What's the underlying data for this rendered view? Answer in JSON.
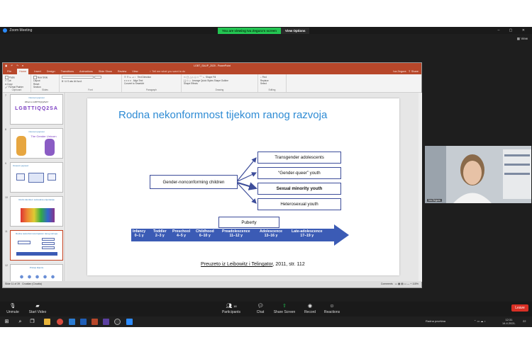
{
  "zoom": {
    "app_title": "Zoom Meeting",
    "share_banner": "You are viewing Iva Zegura's screen",
    "view_options": "View Options",
    "view": "View",
    "presenter_name": "Iva Zegura",
    "controls": {
      "unmute": "Unmute",
      "start_video": "Start Video",
      "participants": "Participants",
      "participants_count": "18",
      "chat": "Chat",
      "share_screen": "Share Screen",
      "record": "Record",
      "reactions": "Reactions",
      "leave": "Leave"
    }
  },
  "ppt": {
    "window_title": "LGBT_SALIP_2020 - PowerPoint",
    "tabs": [
      "File",
      "Home",
      "Insert",
      "Design",
      "Transitions",
      "Animations",
      "Slide Show",
      "Review",
      "View"
    ],
    "active_tab": "Home",
    "tell_me": "Tell me what you want to do",
    "user": "Iva Zegura",
    "share": "Share",
    "ribbon": {
      "clipboard": "Clipboard",
      "paste": "Paste",
      "cut": "Cut",
      "copy": "Copy",
      "format_painter": "Format Painter",
      "slides": "Slides",
      "new_slide": "New Slide",
      "layout": "Layout",
      "reset": "Reset",
      "section": "Section",
      "font": "Font",
      "paragraph": "Paragraph",
      "drawing": "Drawing",
      "editing": "Editing",
      "text_direction": "Text Direction",
      "align_text": "Align Text",
      "convert_smartart": "Convert to SmartArt",
      "arrange": "Arrange",
      "quick_styles": "Quick Styles",
      "shape_fill": "Shape Fill",
      "shape_outline": "Shape Outline",
      "shape_effects": "Shape Effects",
      "find": "Find",
      "replace": "Replace",
      "select": "Select"
    },
    "thumbnails": {
      "numbers": [
        "7",
        "8",
        "9",
        "10",
        "11",
        "12"
      ],
      "t7_title": "Osnovni pojmovi",
      "t7_sub": "What is LGBTTIQQ2SA?",
      "t7_big": "LGBTTIQQ2SA",
      "t8_title": "Osnovni pojmovi",
      "t8_sub": "The Gender Unicorn",
      "t9_title": "Osnovni pojmovi",
      "t10_title": "Rodni identitet i seksualna orijentacija",
      "t11_title": "Rodna nekonformnost tijekom ranog razvoja",
      "t12_title": "Pristup klijentu"
    },
    "status": {
      "slide_of": "Slide 11 of 39",
      "language": "Croatian (Croatia)",
      "comments": "Comments",
      "zoom": "115%"
    }
  },
  "slide": {
    "title": "Rodna nekonformnost tijekom ranog razvoja",
    "source_prefix": "Preuzeto iz ",
    "source_authors": "Leibowitz i Telingator",
    "source_suffix": ", 2011, str. 112",
    "diagram": {
      "root": "Gender-nonconforming children",
      "outcomes": [
        "Transgender adolescents",
        "“Gender-queer” youth",
        "Sexual minority youth",
        "Heterosexual youth"
      ],
      "bold_outcome_index": 2,
      "puberty": "Puberty",
      "stages": [
        {
          "name": "Infancy",
          "age": "0–1 y"
        },
        {
          "name": "Toddler",
          "age": "2–3 y"
        },
        {
          "name": "Preschool",
          "age": "4–5 y"
        },
        {
          "name": "Childhood",
          "age": "6–10 y"
        },
        {
          "name": "Preadolescence",
          "age": "11–12 y"
        },
        {
          "name": "Adolescence",
          "age": "13–16 y"
        },
        {
          "name": "Late-adolescence",
          "age": "17–19 y"
        }
      ]
    }
  },
  "taskbar": {
    "lang": "Radna površina",
    "time": "12:31",
    "date": "14.4.2021.",
    "notif": "22"
  },
  "colors": {
    "ppt_accent": "#b7472a",
    "slide_title": "#2e8bd4",
    "diagram_border": "#3d4d9a",
    "timeline_blue": "#3b5bb5",
    "zoom_green": "#23c552",
    "leave_red": "#d93025"
  }
}
